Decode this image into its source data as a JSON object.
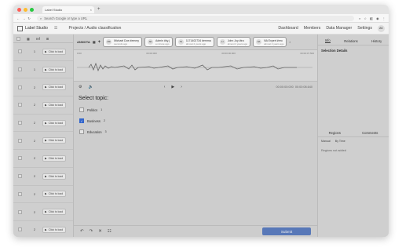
{
  "browser": {
    "tab_title": "Label Studio",
    "url_text": "Search Google or type a URL"
  },
  "app": {
    "name": "Label Studio",
    "breadcrumb": "Projects / Audio classification",
    "nav": [
      "Dashboard",
      "Members",
      "Data Manager",
      "Settings"
    ],
    "avatar_initials": "AK"
  },
  "table": {
    "rows": [
      {
        "num": "1",
        "play": "Click to load"
      },
      {
        "num": "1",
        "play": "Click to load"
      },
      {
        "num": "2",
        "play": "Click to load"
      },
      {
        "num": "2",
        "play": "Click to load"
      },
      {
        "num": "2",
        "play": "Click to load"
      },
      {
        "num": "2",
        "play": "Click to load"
      },
      {
        "num": "2",
        "play": "Click to load"
      },
      {
        "num": "2",
        "play": "Click to load"
      },
      {
        "num": "2",
        "play": "Click to load"
      },
      {
        "num": "2",
        "play": "Click to load"
      },
      {
        "num": "2",
        "play": "Click to load"
      }
    ],
    "header_labels": [
      "ref",
      "⊞"
    ]
  },
  "annotations": {
    "label": "ANNOTA",
    "cards": [
      {
        "name": "Michael Doe #emmy",
        "time": "seconds ago",
        "initials": "MD"
      },
      {
        "name": "Admin #ky.j",
        "time": "a minute ago",
        "initials": "AD"
      },
      {
        "name": "1171402734 #emma",
        "time": "almost 2 years ago",
        "initials": "TS"
      },
      {
        "name": "John Joy #ira",
        "time": "almost 2 years ago",
        "initials": "JJ"
      },
      {
        "name": "NA Expert #ero",
        "time": "almost 2 years ago",
        "initials": "NA"
      }
    ]
  },
  "player": {
    "timeline": [
      "0:00",
      "00:00:000",
      "00:00:00:000",
      "00:00:07.500"
    ],
    "current_time": "00:00:00:000",
    "duration": "00:00:08.640"
  },
  "question": {
    "title": "Select topic:",
    "options": [
      {
        "label": "Politics",
        "hotkey": "1",
        "checked": false
      },
      {
        "label": "Business",
        "hotkey": "2",
        "checked": true
      },
      {
        "label": "Education",
        "hotkey": "3",
        "checked": false
      }
    ]
  },
  "footer": {
    "submit_label": "Submit"
  },
  "sidebar": {
    "tabs": [
      "Info",
      "Relations",
      "History"
    ],
    "title": "Selection Details",
    "region_tabs": [
      "Regions",
      "Comments"
    ],
    "region_controls": [
      "Manual",
      "By Time"
    ],
    "empty": "Regions not added"
  }
}
